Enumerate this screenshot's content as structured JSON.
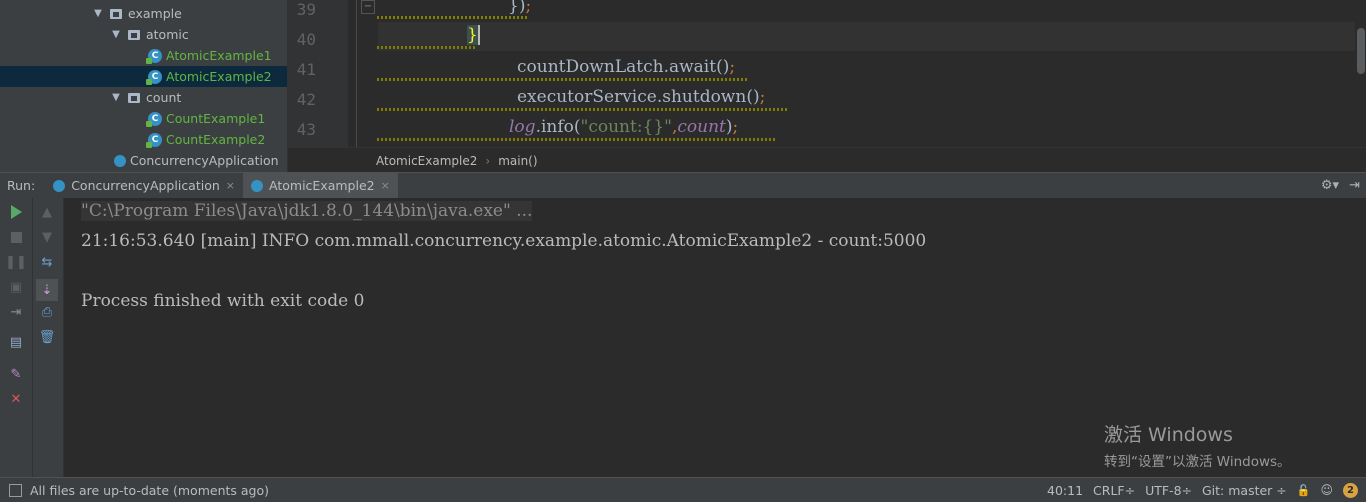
{
  "project_tree": {
    "items": [
      {
        "label": "example",
        "kind": "folder"
      },
      {
        "label": "atomic",
        "kind": "folder"
      },
      {
        "label": "AtomicExample1",
        "kind": "class"
      },
      {
        "label": "AtomicExample2",
        "kind": "class",
        "selected": true
      },
      {
        "label": "count",
        "kind": "folder"
      },
      {
        "label": "CountExample1",
        "kind": "class"
      },
      {
        "label": "CountExample2",
        "kind": "class"
      },
      {
        "label": "ConcurrencyApplication",
        "kind": "app"
      }
    ]
  },
  "editor": {
    "line_numbers": [
      "39",
      "40",
      "41",
      "42",
      "43"
    ],
    "code": {
      "l39_close": "})",
      "l39_semi": ";",
      "l40_brace": "}",
      "l41_var": "countDownLatch.",
      "l41_method": "await",
      "l41_parens": "()",
      "l41_semi": ";",
      "l42_var": "executorService.",
      "l42_method": "shutdown",
      "l42_parens": "()",
      "l42_semi": ";",
      "l43_log": "log",
      "l43_info": ".info(",
      "l43_str": "\"count:{}\"",
      "l43_comma": ",",
      "l43_count": "count",
      "l43_end": ")",
      "l43_semi": ";"
    },
    "fold_mark": "−"
  },
  "breadcrumb": {
    "class": "AtomicExample2",
    "separator": "›",
    "method": "main()"
  },
  "run_panel": {
    "label": "Run:",
    "tabs": [
      {
        "label": "ConcurrencyApplication",
        "close": "×"
      },
      {
        "label": "AtomicExample2",
        "close": "×"
      }
    ],
    "settings_icon": "⚙▾",
    "hide_icon": "⇥"
  },
  "console": {
    "lines": [
      "\"C:\\Program Files\\Java\\jdk1.8.0_144\\bin\\java.exe\" ...",
      "21:16:53.640 [main] INFO com.mmall.concurrency.example.atomic.AtomicExample2 - count:5000",
      "Process finished with exit code 0"
    ]
  },
  "watermark": {
    "title": "激活 Windows",
    "subtitle": "转到“设置”以激活 Windows。"
  },
  "status_bar": {
    "message": "All files are up-to-date (moments ago)",
    "position": "40:11",
    "line_sep": "CRLF÷",
    "encoding": "UTF-8÷",
    "vcs": "Git: master ÷",
    "lock_icon": "🔓",
    "notifications_count": "2"
  },
  "colors": {
    "background": "#2b2b2b",
    "panel": "#3c3f41",
    "class_green": "#62b543",
    "keyword_orange": "#cc7832",
    "method_gold": "#ffc66d",
    "field_purple": "#9876aa",
    "string_green": "#6a8759",
    "run_green": "#59a869",
    "stop_red": "#e05555"
  }
}
